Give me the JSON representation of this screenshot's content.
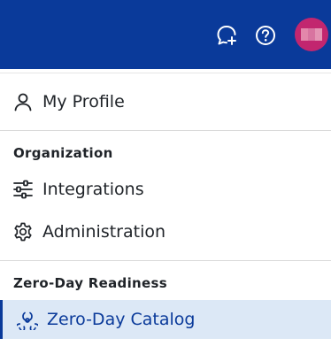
{
  "header": {
    "chat_icon": "chat-sparkle-icon",
    "help_icon": "help-circle-icon",
    "avatar": "user-avatar",
    "brand_color": "#0a3a9a"
  },
  "menu": {
    "profile": {
      "label": "My Profile",
      "icon": "person-icon"
    },
    "org_section": {
      "title": "Organization"
    },
    "integrations": {
      "label": "Integrations",
      "icon": "sliders-icon"
    },
    "administration": {
      "label": "Administration",
      "icon": "gear-icon"
    },
    "zeroday_section": {
      "title": "Zero-Day Readiness"
    },
    "catalog": {
      "label": "Zero-Day Catalog",
      "icon": "biohazard-icon",
      "selected": true
    }
  }
}
